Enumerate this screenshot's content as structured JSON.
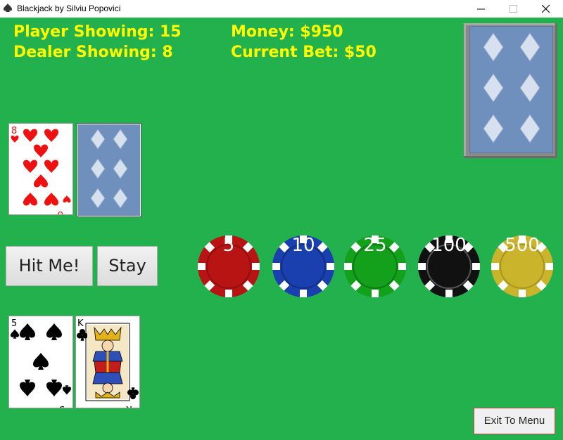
{
  "window": {
    "title": "Blackjack by Silviu Popovici"
  },
  "hud": {
    "player_showing": "Player Showing: 15",
    "dealer_showing": "Dealer Showing: 8",
    "money": "Money: $950",
    "current_bet": "Current Bet: $50"
  },
  "dealer_hand": [
    {
      "rank": "8",
      "suit": "hearts",
      "face_up": true
    },
    {
      "face_up": false
    }
  ],
  "player_hand": [
    {
      "rank": "5",
      "suit": "spades",
      "face_up": true
    },
    {
      "rank": "K",
      "suit": "clubs",
      "face_up": true
    }
  ],
  "buttons": {
    "hit": "Hit Me!",
    "stay": "Stay",
    "exit": "Exit To Menu"
  },
  "chips": [
    {
      "value": "5",
      "color": "#b81414"
    },
    {
      "value": "10",
      "color": "#1a3fae"
    },
    {
      "value": "25",
      "color": "#13a01b"
    },
    {
      "value": "100",
      "color": "#111111"
    },
    {
      "value": "500",
      "color": "#c9b42c"
    }
  ],
  "colors": {
    "table": "#23b14d",
    "hud_text": "#ffff00",
    "card_back": "#6f8fbd",
    "heart": "#ee1111",
    "spade": "#000000"
  }
}
